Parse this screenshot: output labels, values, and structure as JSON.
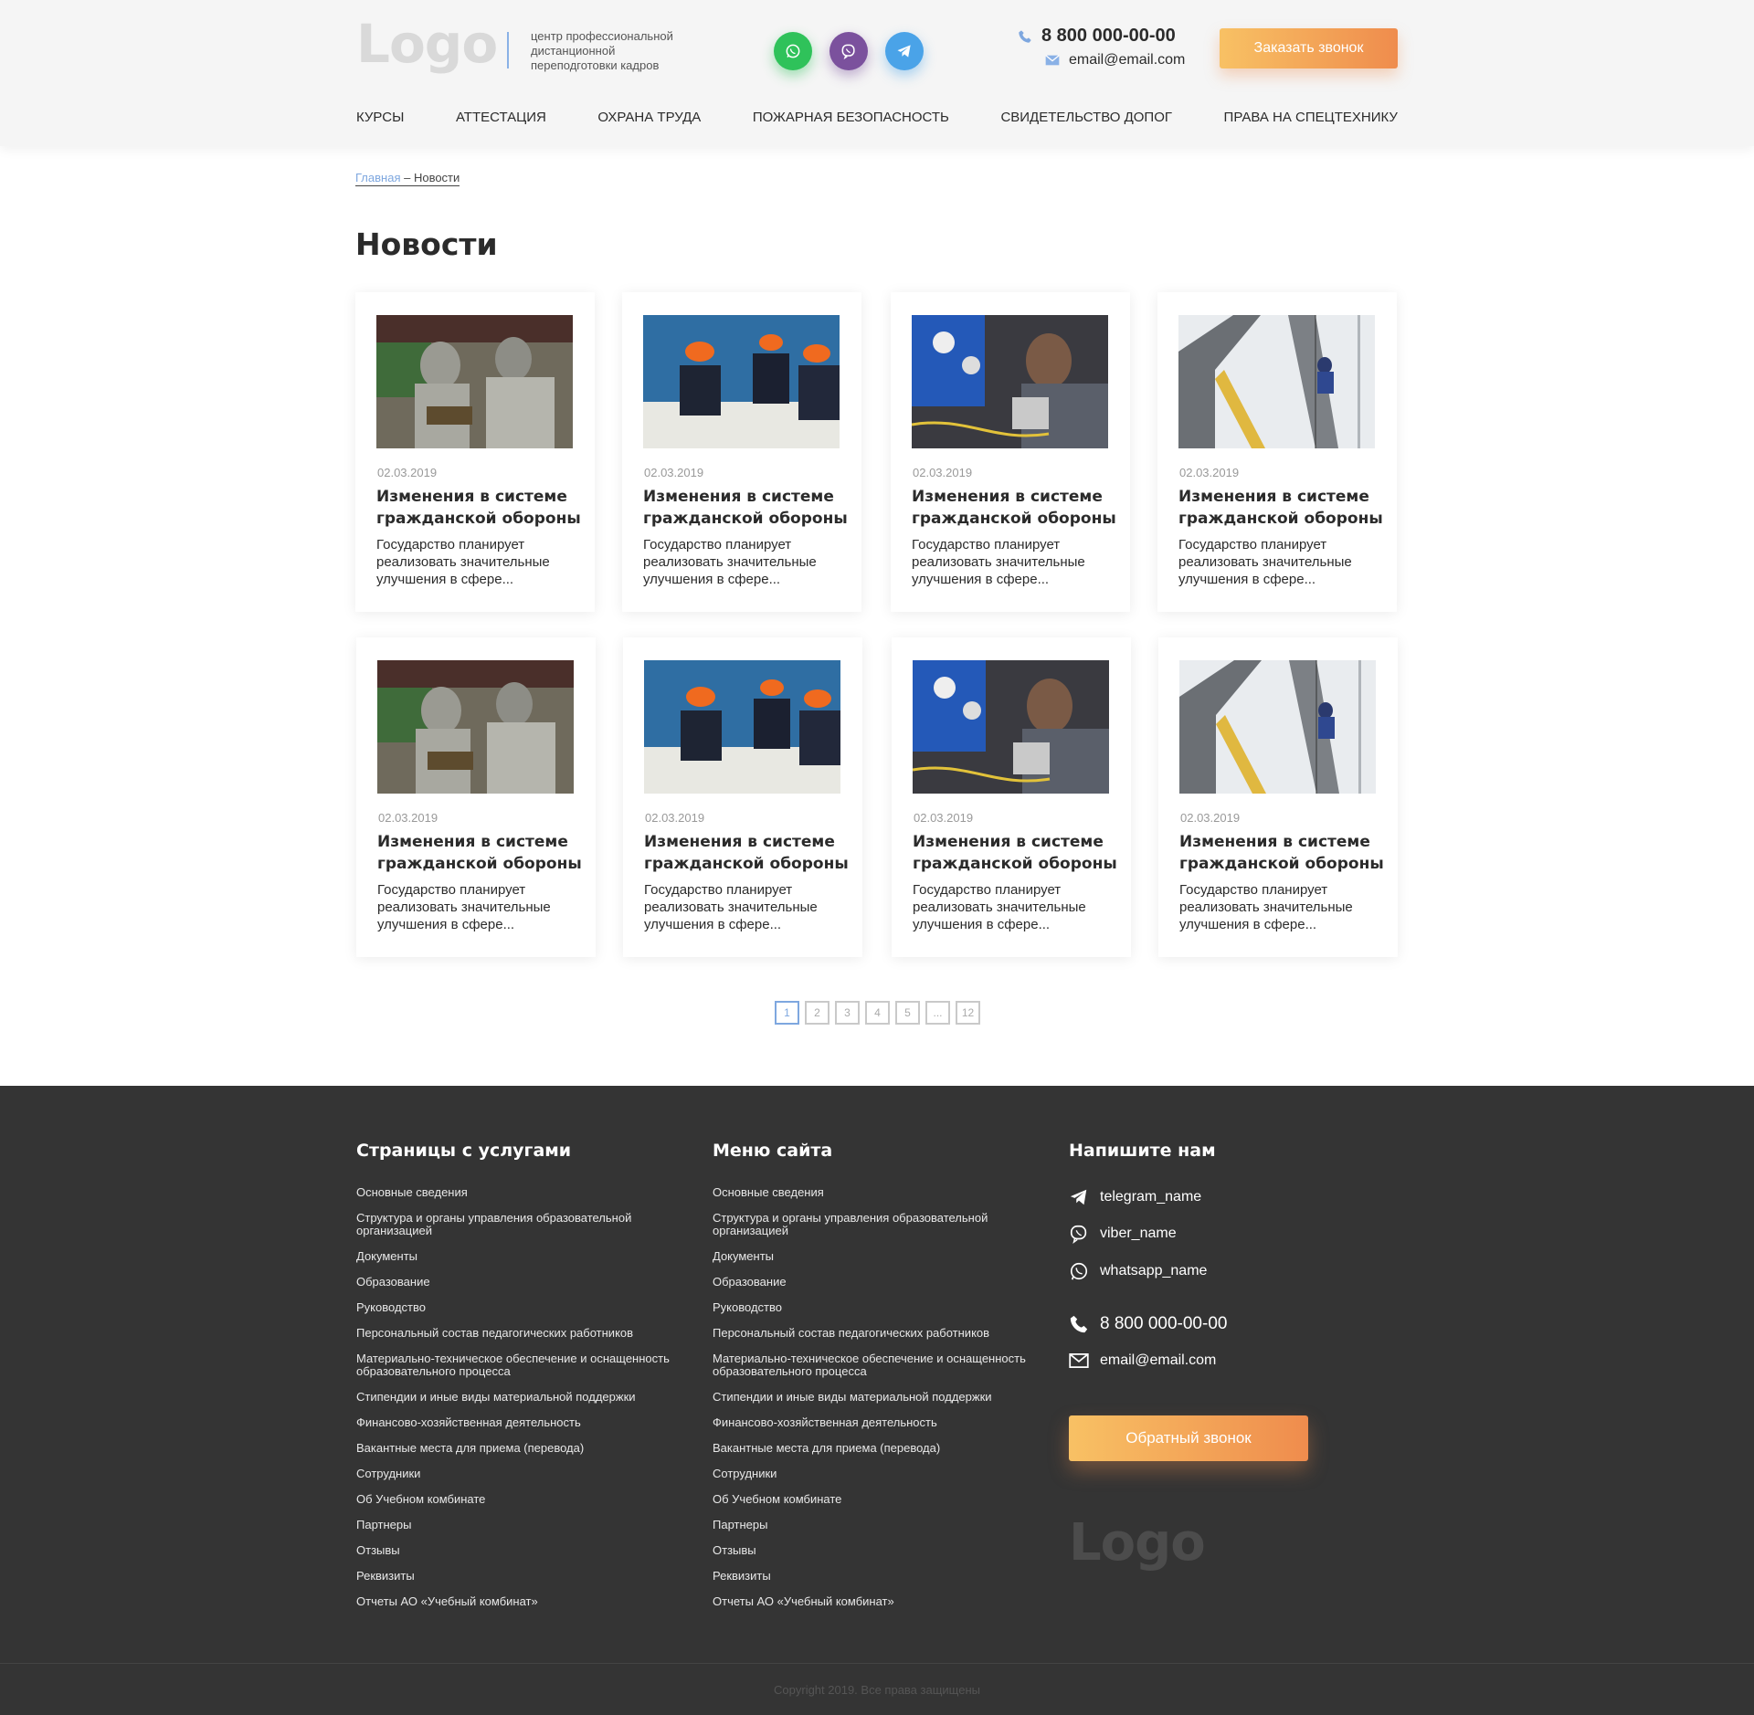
{
  "header": {
    "logo": "Logo",
    "tagline": "центр профессиональной дистанционной переподготовки кадров",
    "phone": "8 800 000-00-00",
    "email": "email@email.com",
    "call_button": "Заказать звонок",
    "social": [
      "whatsapp-icon",
      "viber-icon",
      "telegram-icon"
    ],
    "nav": [
      "КУРСЫ",
      "АТТЕСТАЦИЯ",
      "ОХРАНА ТРУДА",
      "ПОЖАРНАЯ БЕЗОПАСНОСТЬ",
      "СВИДЕТЕЛЬСТВО ДОПОГ",
      "ПРАВА НА СПЕЦТЕХНИКУ"
    ]
  },
  "breadcrumb": {
    "home": "Главная",
    "separator": " – ",
    "current": "Новости"
  },
  "page_title": "Новости",
  "news": [
    {
      "date": "02.03.2019",
      "title": "Изменения в системе гражданской обороны",
      "text": "Государство планирует реализовать значительные улучшения в сфере...",
      "image": "gas-masks-photo"
    },
    {
      "date": "02.03.2019",
      "title": "Изменения в системе гражданской обороны",
      "text": "Государство планирует реализовать значительные улучшения в сфере...",
      "image": "workers-hardhats-photo"
    },
    {
      "date": "02.03.2019",
      "title": "Изменения в системе гражданской обороны",
      "text": "Государство планирует реализовать значительные улучшения в сфере...",
      "image": "welder-equipment-photo"
    },
    {
      "date": "02.03.2019",
      "title": "Изменения в системе гражданской обороны",
      "text": "Государство планирует реализовать значительные улучшения в сфере...",
      "image": "industrial-climber-photo"
    },
    {
      "date": "02.03.2019",
      "title": "Изменения в системе гражданской обороны",
      "text": "Государство планирует реализовать значительные улучшения в сфере...",
      "image": "gas-masks-photo"
    },
    {
      "date": "02.03.2019",
      "title": "Изменения в системе гражданской обороны",
      "text": "Государство планирует реализовать значительные улучшения в сфере...",
      "image": "workers-hardhats-photo"
    },
    {
      "date": "02.03.2019",
      "title": "Изменения в системе гражданской обороны",
      "text": "Государство планирует реализовать значительные улучшения в сфере...",
      "image": "welder-equipment-photo"
    },
    {
      "date": "02.03.2019",
      "title": "Изменения в системе гражданской обороны",
      "text": "Государство планирует реализовать значительные улучшения в сфере...",
      "image": "industrial-climber-photo"
    }
  ],
  "pagination": [
    "1",
    "2",
    "3",
    "4",
    "5",
    "...",
    "12"
  ],
  "pagination_current": "1",
  "footer": {
    "services_title": "Страницы с услугами",
    "menu_title": "Меню сайта",
    "contact_title": "Напишите нам",
    "links": [
      "Основные сведения",
      "Структура и органы управления образовательной организацией",
      "Документы",
      "Образование",
      "Руководство",
      "Персональный состав педагогических работников",
      "Материально-техническое обеспечение и оснащенность образовательного процесса",
      "Стипендии и иные виды материальной поддержки",
      "Финансово-хозяйственная деятельность",
      "Вакантные места для приема (перевода)",
      "Сотрудники",
      "Об Учебном комбинате",
      "Партнеры",
      "Отзывы",
      "Реквизиты",
      "Отчеты АО «Учебный комбинат»"
    ],
    "telegram": "telegram_name",
    "viber": "viber_name",
    "whatsapp": "whatsapp_name",
    "phone": "8 800 000-00-00",
    "email": "email@email.com",
    "callback_button": "Обратный звонок",
    "logo": "Logo",
    "copyright": "Copyright 2019. Все права защищены"
  },
  "colors": {
    "accent_blue": "#7ea7df",
    "button_from": "#f8c164",
    "button_to": "#ef8c4d",
    "footer_bg": "#343434"
  }
}
